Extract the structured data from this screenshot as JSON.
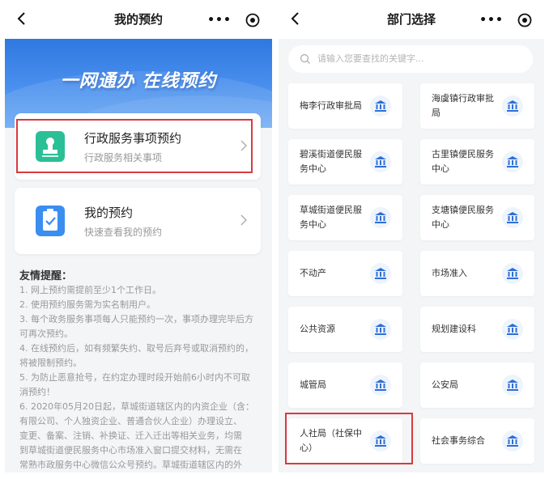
{
  "left": {
    "nav_title": "我的预约",
    "capsule_more": "•••",
    "banner_title": "一网通办  在线预约",
    "cards": [
      {
        "title": "行政服务事项预约",
        "subtitle": "行政服务相关事项"
      },
      {
        "title": "我的预约",
        "subtitle": "快速查看我的预约"
      }
    ],
    "tips_title": "友情提醒：",
    "tips": [
      "1. 网上预约需提前至少1个工作日。",
      "2. 使用预约服务需为实名制用户。",
      "3. 每个政务服务事项每人只能预约一次，事项办理完毕后方",
      "可再次预约。",
      "4. 在线预约后，如有频繁失约、取号后弃号或取消预约的，",
      "将被限制预约。",
      "5. 为防止恶意抢号，在约定办理时段开始前6小时内不可取",
      "消预约！",
      "6. 2020年05月20日起，草城街道辖区内的内资企业（含：",
      "有限公司、个人独资企业、普通合伙人企业）办理设立、",
      "变更、备案、注销、补换证、迁入迁出等相关业务，均需",
      "到草城街道便民服务中心市场准入窗口提交材料，无需在",
      "常熟市政服务中心微信公众号预约。草城街道辖区内的外"
    ]
  },
  "right": {
    "nav_title": "部门选择",
    "capsule_more": "•••",
    "search_placeholder": "请输入您要查找的关键字...",
    "departments": [
      "梅李行政审批局",
      "海虞镇行政审批局",
      "碧溪街道便民服务中心",
      "古里镇便民服务中心",
      "草城街道便民服务中心",
      "支塘镇便民服务中心",
      "不动产",
      "市场准入",
      "公共资源",
      "规划建设科",
      "城管局",
      "公安局",
      "人社局（社保中心）",
      "社会事务综合"
    ]
  },
  "colors": {
    "highlight": "#d93a3f",
    "banner": "#2f78e0",
    "bank_icon": "#2e6fd6",
    "service_icon": "#2bbf96",
    "mine_icon": "#3a8ef0"
  },
  "icons": {
    "back": "chevron-left-icon",
    "more": "more-dots-icon",
    "target": "target-icon",
    "search": "search-icon",
    "chevron": "chevron-right-icon",
    "department": "bank-building-icon",
    "service": "stamp-icon",
    "appointment": "clipboard-check-icon"
  }
}
